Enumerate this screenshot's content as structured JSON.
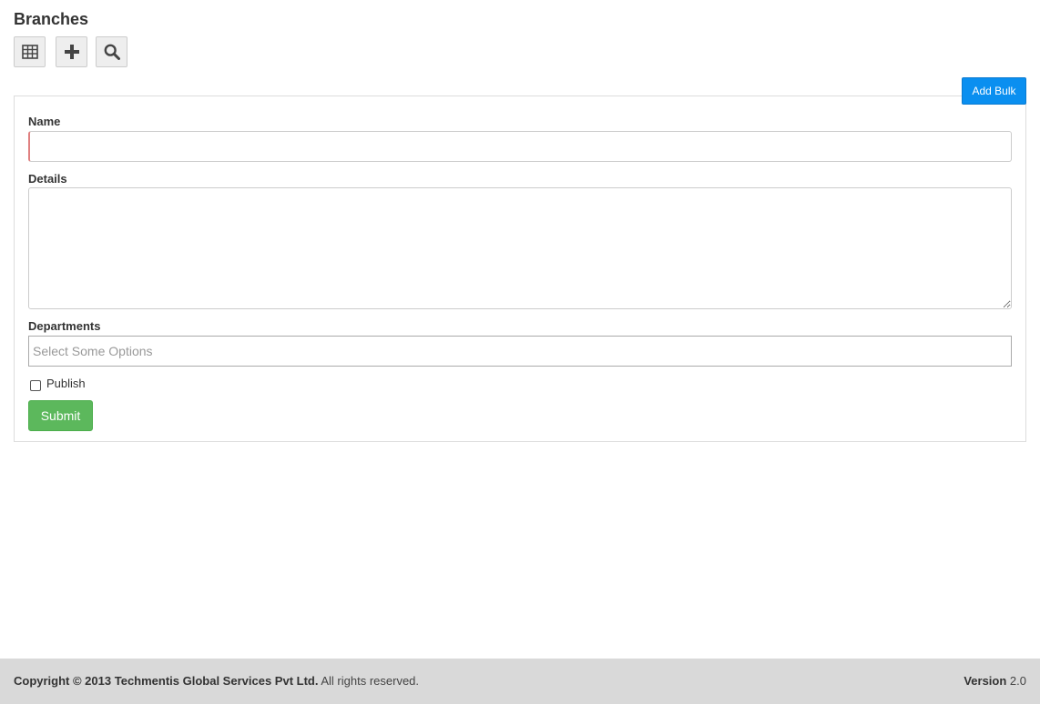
{
  "page": {
    "title": "Branches"
  },
  "toolbar": {
    "buttons": [
      {
        "icon": "table-icon"
      },
      {
        "icon": "plus-icon"
      },
      {
        "icon": "search-icon"
      }
    ]
  },
  "add_bulk_label": "Add Bulk",
  "form": {
    "name": {
      "label": "Name",
      "value": ""
    },
    "details": {
      "label": "Details",
      "value": ""
    },
    "departments": {
      "label": "Departments",
      "placeholder": "Select Some Options"
    },
    "publish": {
      "label": "Publish",
      "checked": false
    },
    "submit_label": "Submit"
  },
  "footer": {
    "copyright_prefix": "Copyright © 2013",
    "company": "Techmentis Global Services Pvt Ltd.",
    "rights": "All rights reserved.",
    "version_label": "Version",
    "version_value": "2.0"
  },
  "colors": {
    "add_bulk": "#0a8ff0",
    "submit": "#5cb85c",
    "footer_bg": "#d9d9d9",
    "invalid_border": "#e08080"
  }
}
